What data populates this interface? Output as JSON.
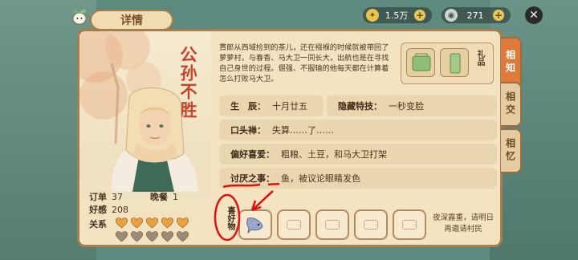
{
  "header": {
    "title": "详情"
  },
  "currency": [
    {
      "icon": "coin-icon",
      "value": "1.5万"
    },
    {
      "icon": "gem-icon",
      "value": "271"
    }
  ],
  "character": {
    "name": "公孙不胜",
    "description": "貫郎从西域捡到的茶儿，还在襁褓的时候就被带回了萝萝村，与春香、马大卫一同长大，出航也是在寻找自己身世的过程。倔强、不服输的他每天都在计算着怎么打败马大卫。",
    "stats": {
      "order_label": "订单",
      "order_value": "37",
      "dinner_label": "晚餐",
      "dinner_value": "1",
      "favor_label": "好感",
      "favor_value": "208",
      "relation_label": "关系"
    },
    "hearts_filled": 5,
    "hearts_total": 10
  },
  "gift": {
    "label": "礼品"
  },
  "info": {
    "birthday_label": "生　辰：",
    "birthday_value": "十月廿五",
    "skill_label": "隐藏特技：",
    "skill_value": "一秒变脸",
    "catchphrase_label": "口头禅：",
    "catchphrase_value": "失算……了……",
    "hobby_label": "偏好喜爱：",
    "hobby_value": "粗粮、土豆，和马大卫打架",
    "dislike_label": "讨厌之事：",
    "dislike_value": "鱼，被议论眼睛发色"
  },
  "favorites": {
    "label": "喜好物",
    "slots": 5,
    "hint": "夜深露重，请明日再邀请村民"
  },
  "tabs": [
    {
      "label": "相知",
      "active": true
    },
    {
      "label": "相交",
      "active": false
    },
    {
      "label": "相忆",
      "active": false
    }
  ],
  "colors": {
    "accent": "#e07a3a",
    "name": "#c2452f",
    "annotation": "#e01010"
  }
}
